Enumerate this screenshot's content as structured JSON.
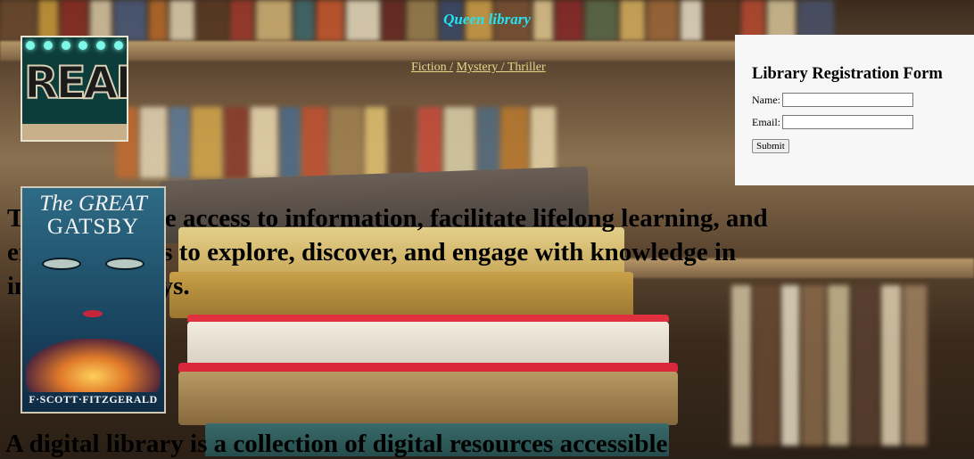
{
  "header": {
    "title": "Queen library"
  },
  "nav": {
    "links": [
      {
        "label": "Fiction /"
      },
      {
        "label": "Mystery / Thriller"
      }
    ]
  },
  "logo": {
    "text": "READ!"
  },
  "form": {
    "title": "Library Registration Form",
    "name_label": "Name:",
    "name_value": "",
    "email_label": "Email:",
    "email_value": "",
    "submit_label": "Submit"
  },
  "book_cover": {
    "title_line1": "The GREAT",
    "title_line2": "GATSBY",
    "author": "F·SCOTT·FITZGERALD"
  },
  "mission_text": "To democratize access to information, facilitate lifelong learning, and empower users to explore, discover, and engage with knowledge in innovative ways.",
  "intro_text": "A digital library is a collection of digital resources accessible",
  "colors": {
    "title": "#24e3f0",
    "nav_link": "#e6d98a",
    "form_bg": "#f7f7f7"
  }
}
